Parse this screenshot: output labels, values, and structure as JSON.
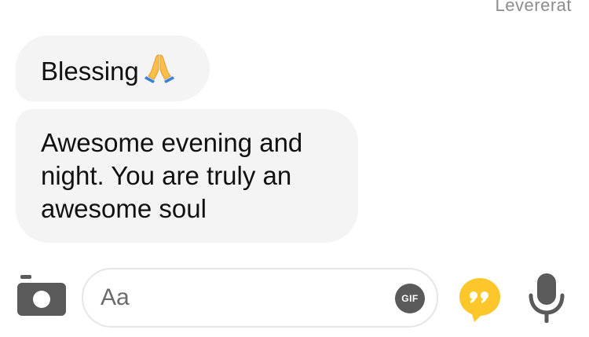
{
  "status": {
    "delivery_text": "Levererat"
  },
  "messages": [
    {
      "text": "Blessing",
      "emoji": "🙏",
      "emoji_icon": "folded-hands-icon"
    },
    {
      "text": "Awesome evening and night. You are truly an awesome soul"
    }
  ],
  "composer": {
    "placeholder": "Aa",
    "gif_label": "GIF",
    "camera_icon": "camera-icon",
    "quote_icon": "quote-bubble-icon",
    "mic_icon": "microphone-icon"
  },
  "colors": {
    "bubble_bg": "#f4f4f4",
    "text": "#111111",
    "status_text": "#8c8c8c",
    "icon_gray": "#5a5a5a",
    "accent_yellow": "#fdc62a"
  }
}
